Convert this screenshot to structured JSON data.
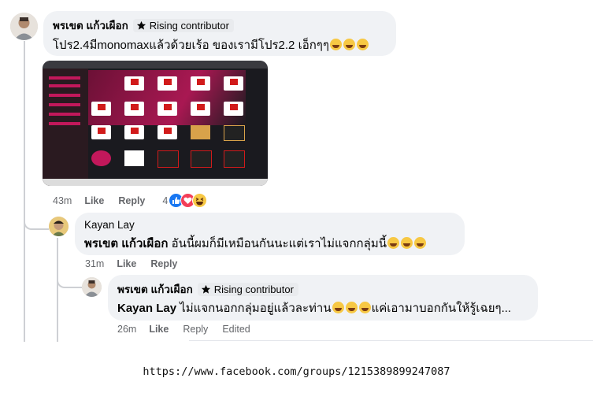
{
  "comment1": {
    "author": "พรเขต แก้วเผือก",
    "badge": "Rising contributor",
    "text": "โปร2.4มีmonomaxแล้วด้วยเร้อ ของเรามีโปร2.2 เอ็กๆๆ",
    "emoji_count": 3,
    "time": "43m",
    "like": "Like",
    "reply": "Reply",
    "reaction_count": "4",
    "reactions": [
      "like-reaction-icon",
      "love-reaction-icon",
      "haha-reaction-icon"
    ]
  },
  "comment2": {
    "author": "Kayan Lay",
    "mention": "พรเขต แก้วเผือก",
    "text": " อันนี้ผมก็มีเหมือนกันนะแต่เราไม่แจกกลุ่มนี้",
    "emoji_count": 3,
    "time": "31m",
    "like": "Like",
    "reply": "Reply"
  },
  "comment3": {
    "author": "พรเขต แก้วเผือก",
    "badge": "Rising contributor",
    "mention": "Kayan Lay",
    "text_before": " ไม่แจกนอกกลุ่มอยู่แล้วละท่าน",
    "text_after": "แค่เอามาบอกกันให้รู้เฉยๆ...",
    "emoji_count": 3,
    "time": "26m",
    "like": "Like",
    "reply": "Reply",
    "edited": "Edited"
  },
  "url": "https://www.facebook.com/groups/1215389899247087",
  "colors": {
    "bubble": "#f0f2f5",
    "meta": "#65676b",
    "like_blue": "#1877f2",
    "love_red": "#f33e58",
    "haha_yellow": "#f7c844"
  }
}
